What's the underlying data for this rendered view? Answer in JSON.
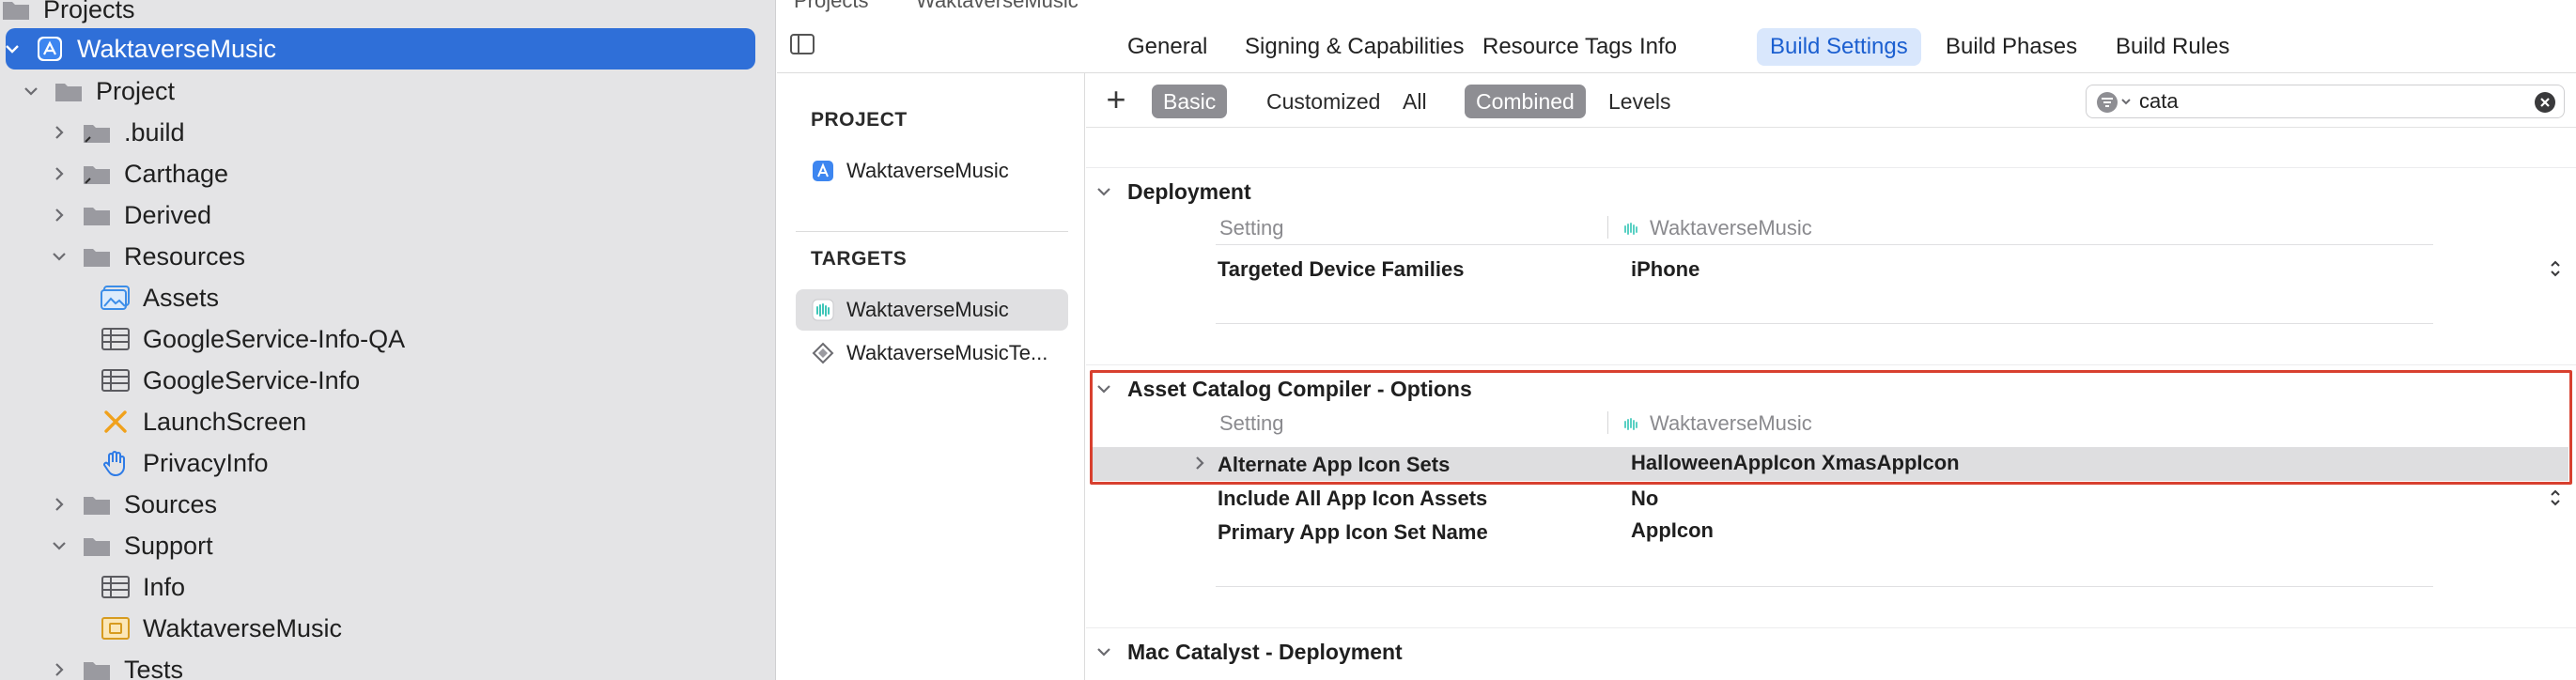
{
  "navigator": {
    "items": [
      {
        "label": "Projects",
        "icon": "folder-icon"
      },
      {
        "label": "WaktaverseMusic",
        "icon": "app-project-icon"
      },
      {
        "label": "Project",
        "icon": "folder-icon"
      },
      {
        "label": ".build",
        "icon": "folder-alias-icon"
      },
      {
        "label": "Carthage",
        "icon": "folder-alias-icon"
      },
      {
        "label": "Derived",
        "icon": "folder-icon"
      },
      {
        "label": "Resources",
        "icon": "folder-icon"
      },
      {
        "label": "Assets",
        "icon": "asset-catalog-icon"
      },
      {
        "label": "GoogleService-Info-QA",
        "icon": "plist-icon"
      },
      {
        "label": "GoogleService-Info",
        "icon": "plist-icon"
      },
      {
        "label": "LaunchScreen",
        "icon": "storyboard-icon"
      },
      {
        "label": "PrivacyInfo",
        "icon": "privacy-hand-icon"
      },
      {
        "label": "Sources",
        "icon": "folder-icon"
      },
      {
        "label": "Support",
        "icon": "folder-icon"
      },
      {
        "label": "Info",
        "icon": "plist-icon"
      },
      {
        "label": "WaktaverseMusic",
        "icon": "entitlements-icon"
      },
      {
        "label": "Tests",
        "icon": "folder-icon"
      }
    ]
  },
  "jumpbar": {
    "path_project": "Projects",
    "path_target": "WaktaverseMusic"
  },
  "tabs": [
    "General",
    "Signing & Capabilities",
    "Resource Tags",
    "Info",
    "Build Settings",
    "Build Phases",
    "Build Rules"
  ],
  "targets_pane": {
    "project_heading": "PROJECT",
    "project_item": "WaktaverseMusic",
    "targets_heading": "TARGETS",
    "targets": [
      "WaktaverseMusic",
      "WaktaverseMusicTe..."
    ]
  },
  "filter": {
    "add": "+",
    "basic": "Basic",
    "customized": "Customized",
    "all": "All",
    "combined": "Combined",
    "levels": "Levels",
    "search_value": "cata"
  },
  "sections": {
    "deployment": {
      "title": "Deployment",
      "col_setting": "Setting",
      "col_target": "WaktaverseMusic",
      "rows": [
        {
          "name": "Targeted Device Families",
          "value": "iPhone"
        }
      ]
    },
    "asset_catalog": {
      "title": "Asset Catalog Compiler - Options",
      "col_setting": "Setting",
      "col_target": "WaktaverseMusic",
      "rows": [
        {
          "name": "Alternate App Icon Sets",
          "value": "HalloweenAppIcon XmasAppIcon"
        },
        {
          "name": "Include All App Icon Assets",
          "value": "No"
        },
        {
          "name": "Primary App Icon Set Name",
          "value": "AppIcon"
        }
      ]
    },
    "mac_catalyst": {
      "title": "Mac Catalyst - Deployment"
    }
  },
  "colors": {
    "selection_blue": "#2f6fd8",
    "active_tab_bg": "#d9e7fc",
    "highlight_box": "#d8402f",
    "filter_on": "#8e8e93"
  }
}
